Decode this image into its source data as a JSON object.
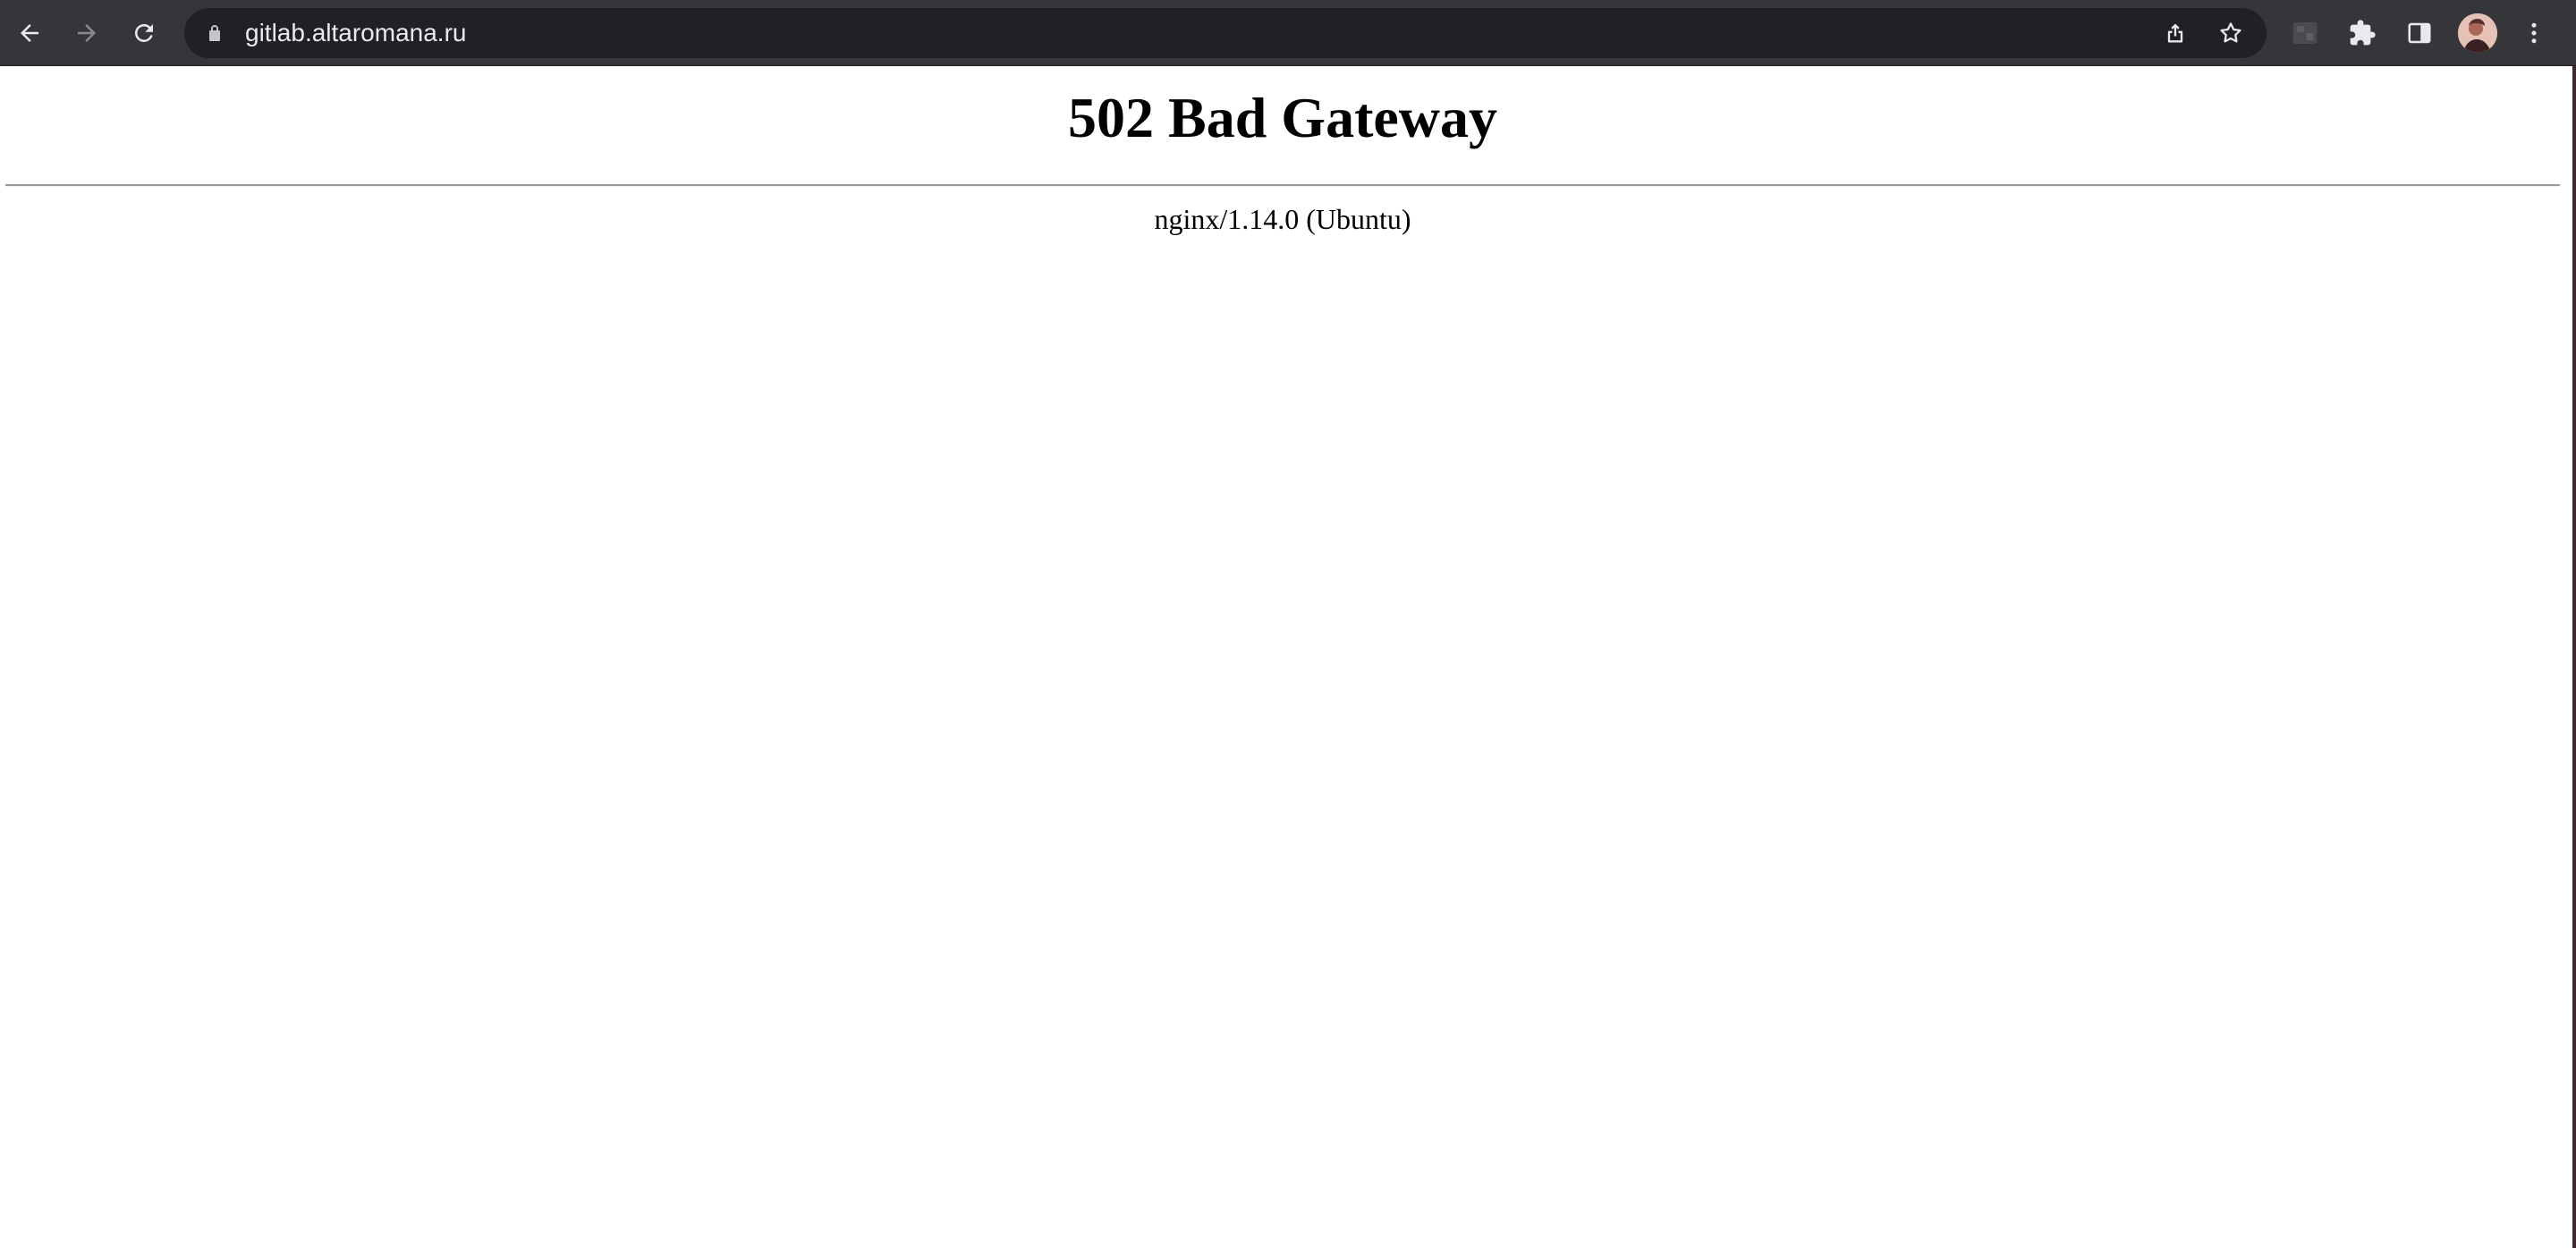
{
  "browser": {
    "url": "gitlab.altaromana.ru",
    "icons": {
      "back": "arrow-left-icon",
      "forward": "arrow-right-icon",
      "reload": "reload-icon",
      "lock": "lock-icon",
      "share": "share-icon",
      "bookmark": "star-icon",
      "extension_tile": "extension-tile-icon",
      "extensions": "puzzle-icon",
      "side_panel": "side-panel-icon",
      "profile": "avatar",
      "menu": "kebab-menu-icon"
    },
    "colors": {
      "toolbar": "#35363a",
      "omnibox": "#202124",
      "icon": "#e8eaed",
      "icon_disabled": "#8a8b8f"
    }
  },
  "page": {
    "heading": "502 Bad Gateway",
    "server_info": "nginx/1.14.0 (Ubuntu)"
  }
}
